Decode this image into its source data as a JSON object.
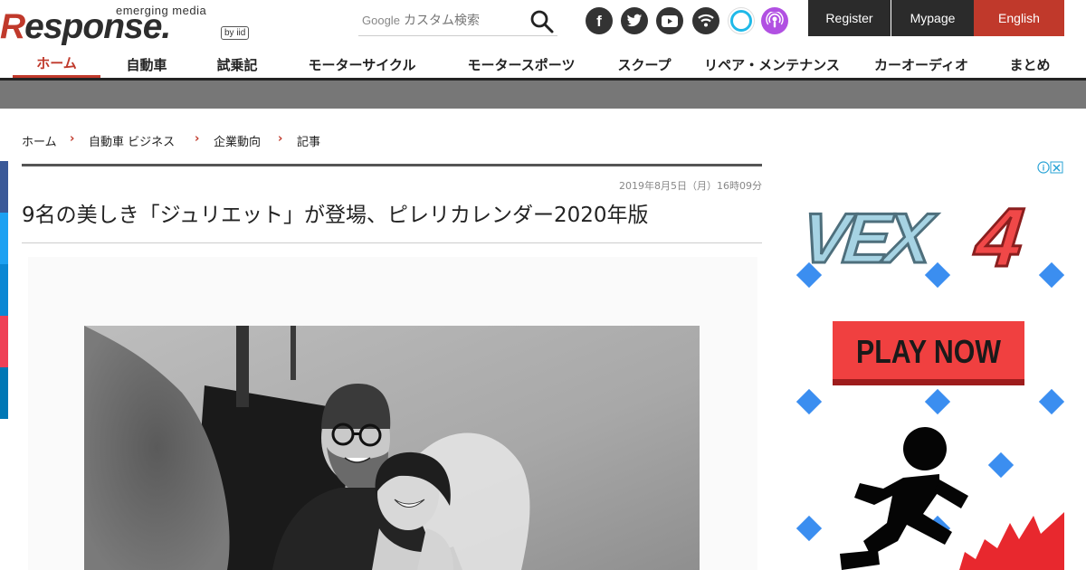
{
  "logo": {
    "tagline": "emerging media",
    "wordmark_r": "R",
    "wordmark_rest": "esponse.",
    "by": "by iid"
  },
  "search": {
    "google_label": "Google",
    "placeholder": "カスタム検索"
  },
  "social_icons": [
    "facebook-icon",
    "twitter-icon",
    "youtube-icon",
    "rss-icon",
    "alexa-icon",
    "podcast-icon"
  ],
  "top_buttons": {
    "register": "Register",
    "mypage": "Mypage",
    "english": "English"
  },
  "nav": {
    "items": [
      "ホーム",
      "自動車",
      "試乗記",
      "モーターサイクル",
      "モータースポーツ",
      "スクープ",
      "リペア・メンテナンス",
      "カーオーディオ",
      "まとめ"
    ]
  },
  "breadcrumbs": {
    "items": [
      "ホーム",
      "自動車 ビジネス",
      "企業動向",
      "記事"
    ],
    "separator": "›"
  },
  "article": {
    "date": "2019年8月5日（月）16時09分",
    "title": "9名の美しき「ジュリエット」が登場、ピレリカレンダー2020年版"
  },
  "ad": {
    "logo_text": "VEX",
    "logo_number": "4",
    "cta": "PLAY NOW"
  },
  "colors": {
    "accent": "#c0392b",
    "dark_button": "#2b2b2b",
    "english_button": "#c0392b",
    "nav_border": "#222222",
    "grey_band": "#777777"
  }
}
